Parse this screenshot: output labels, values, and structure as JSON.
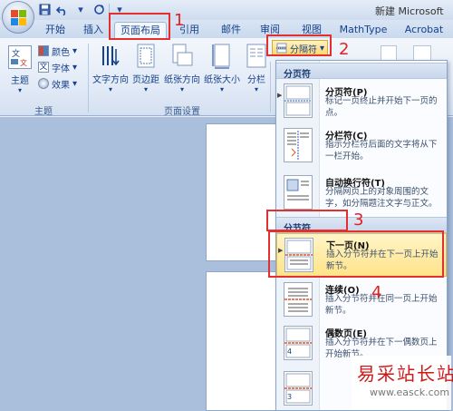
{
  "title_bar": {
    "doc_title": "新建 Microsoft",
    "qat": {
      "save_icon": "save-icon",
      "undo_icon": "undo-icon",
      "redo_icon": "redo-icon",
      "more_label": "▾"
    }
  },
  "tabs": [
    {
      "label": "开始"
    },
    {
      "label": "插入"
    },
    {
      "label": "页面布局"
    },
    {
      "label": "引用"
    },
    {
      "label": "邮件"
    },
    {
      "label": "审阅"
    },
    {
      "label": "视图"
    },
    {
      "label": "MathType"
    },
    {
      "label": "Acrobat"
    }
  ],
  "ribbon": {
    "theme_group": {
      "label": "主题",
      "themes_button": "主题",
      "colors": "颜色",
      "fonts": "字体",
      "effects": "效果"
    },
    "page_setup_group": {
      "label": "页面设置",
      "text_direction": "文字方向",
      "margins": "页边距",
      "orientation": "纸张方向",
      "size": "纸张大小",
      "columns": "分栏",
      "breaks_button": "分隔符"
    }
  },
  "menu": {
    "page_breaks_header": "分页符",
    "section_breaks_header": "分节符",
    "items": [
      {
        "title": "分页符(P)",
        "desc": "标记一页终止并开始下一页的点。"
      },
      {
        "title": "分栏符(C)",
        "desc": "指示分栏符后面的文字将从下一栏开始。"
      },
      {
        "title": "自动换行符(T)",
        "desc": "分隔网页上的对象周围的文字，如分隔题注文字与正文。"
      },
      {
        "title": "下一页(N)",
        "desc": "插入分节符并在下一页上开始新节。"
      },
      {
        "title": "连续(O)",
        "desc": "插入分节符并在同一页上开始新节。"
      },
      {
        "title": "偶数页(E)",
        "desc": "插入分节符并在下一偶数页上开始新节。"
      }
    ]
  },
  "annotations": [
    "1",
    "2",
    "3",
    "4"
  ],
  "watermark": {
    "text": "易采站长站",
    "url": "www.easck.com"
  },
  "colors": {
    "annotation_red": "#e23030",
    "ribbon_blue": "#15428b",
    "highlight": "#ffe38a"
  }
}
